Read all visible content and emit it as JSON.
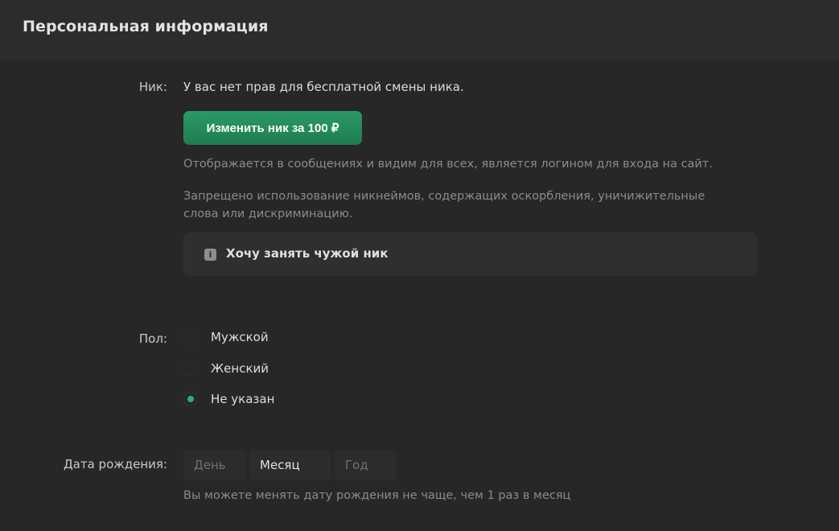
{
  "section": {
    "title": "Персональная информация"
  },
  "nick": {
    "label": "Ник:",
    "no_rights_text": "У вас нет прав для бесплатной смены ника.",
    "change_button": "Изменить ник за 100 ₽",
    "hint_display": "Отображается в сообщениях и видим для всех, является логином для входа на сайт.",
    "hint_forbidden": "Запрещено использование никнеймов, содержащих оскорбления, уничижительные слова или дискриминацию.",
    "claim_text": "Хочу занять чужой ник",
    "claim_icon": "info-icon"
  },
  "gender": {
    "label": "Пол:",
    "options": [
      {
        "label": "Мужской",
        "checked": false
      },
      {
        "label": "Женский",
        "checked": false
      },
      {
        "label": "Не указан",
        "checked": true
      }
    ]
  },
  "birth": {
    "label": "Дата рождения:",
    "day_placeholder": "День",
    "month_value": "Месяц",
    "year_placeholder": "Год",
    "hint": "Вы можете менять дату рождения не чаще, чем 1 раз в месяц"
  },
  "colors": {
    "background": "#272727",
    "accent": "#26b07a",
    "button": "#238a5a"
  }
}
